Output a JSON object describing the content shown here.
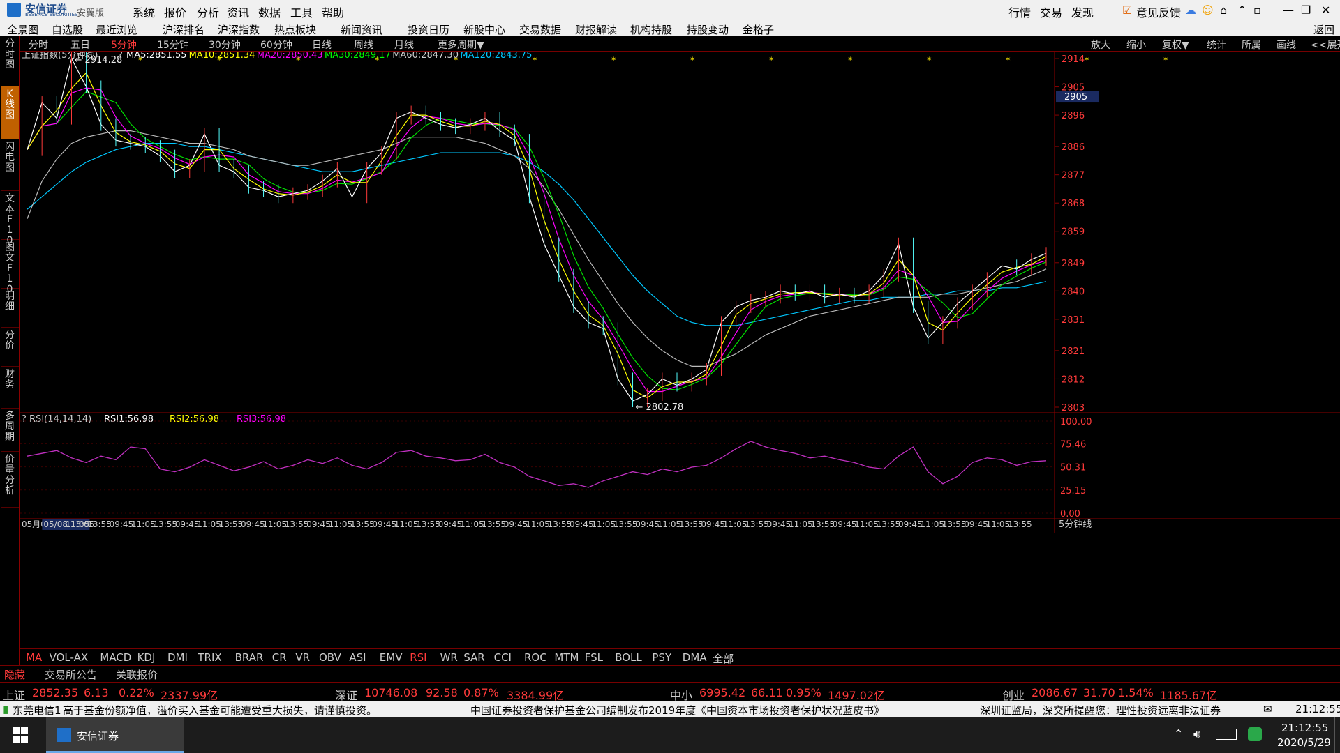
{
  "app": {
    "logo_text": "安信证券",
    "logo_sub": "ESSENCE SECURITIES",
    "version": "安翼版",
    "menu": [
      "系统",
      "报价",
      "分析",
      "资讯",
      "数据",
      "工具",
      "帮助"
    ],
    "right_menu": [
      "行情",
      "交易",
      "发现"
    ],
    "feedback": "意见反馈"
  },
  "toolbar2": {
    "items": [
      "全景图",
      "自选股",
      "最近浏览",
      "沪深排名",
      "沪深指数",
      "热点板块",
      "新闻资讯",
      "投资日历",
      "新股中心",
      "交易数据",
      "财报解读",
      "机构持股",
      "持股变动",
      "金格子"
    ],
    "back": "返回"
  },
  "sidebar": {
    "tabs": [
      "分时图",
      "K线图",
      "闪电图",
      "文本F10",
      "图文F10",
      "明细",
      "分价",
      "财务",
      "多周期",
      "价量分析"
    ]
  },
  "periods": {
    "items": [
      "分时",
      "五日",
      "5分钟",
      "15分钟",
      "30分钟",
      "60分钟",
      "日线",
      "周线",
      "月线",
      "更多周期▼"
    ],
    "active": "5分钟",
    "right_buttons": [
      "放大",
      "缩小",
      "复权▼",
      "统计",
      "所属",
      "画线",
      "<<展开"
    ]
  },
  "chart_data": {
    "type": "line",
    "title": "上证指数(5分钟线)",
    "ma_legend": [
      {
        "name": "MA5",
        "value": "2851.55",
        "color": "#ffffff"
      },
      {
        "name": "MA10",
        "value": "2851.34",
        "color": "#ffff00"
      },
      {
        "name": "MA20",
        "value": "2850.43",
        "color": "#ff00ff"
      },
      {
        "name": "MA30",
        "value": "2849.17",
        "color": "#00ff00"
      },
      {
        "name": "MA60",
        "value": "2847.30",
        "color": "#cccccc"
      },
      {
        "name": "MA120",
        "value": "2843.75",
        "color": "#00c8ff"
      }
    ],
    "y_ticks": [
      2914,
      2905,
      2896,
      2886,
      2877,
      2868,
      2859,
      2849,
      2840,
      2831,
      2821,
      2812,
      2803
    ],
    "ylim": [
      2803,
      2914
    ],
    "current_price_tag": "2905",
    "high_label": "2914.28",
    "low_label": "2802.78",
    "price_path": [
      2885,
      2900,
      2895,
      2914,
      2905,
      2893,
      2888,
      2887,
      2886,
      2883,
      2878,
      2880,
      2890,
      2880,
      2878,
      2873,
      2872,
      2870,
      2871,
      2872,
      2875,
      2879,
      2870,
      2879,
      2884,
      2895,
      2897,
      2895,
      2893,
      2892,
      2893,
      2895,
      2891,
      2888,
      2870,
      2855,
      2845,
      2835,
      2830,
      2828,
      2812,
      2805,
      2807,
      2812,
      2810,
      2812,
      2815,
      2830,
      2835,
      2837,
      2838,
      2840,
      2839,
      2840,
      2838,
      2839,
      2838,
      2840,
      2845,
      2855,
      2835,
      2825,
      2830,
      2836,
      2840,
      2844,
      2848,
      2847,
      2850,
      2852
    ],
    "ma60_path": [
      2863,
      2875,
      2882,
      2887,
      2889,
      2890,
      2891,
      2891,
      2890,
      2889,
      2888,
      2887,
      2887,
      2886,
      2885,
      2883,
      2882,
      2881,
      2880,
      2880,
      2881,
      2882,
      2883,
      2884,
      2885,
      2887,
      2889,
      2889,
      2889,
      2889,
      2888,
      2887,
      2885,
      2883,
      2879,
      2873,
      2866,
      2858,
      2850,
      2843,
      2836,
      2830,
      2825,
      2821,
      2818,
      2816,
      2816,
      2818,
      2820,
      2823,
      2826,
      2828,
      2830,
      2832,
      2833,
      2834,
      2835,
      2836,
      2837,
      2838,
      2838,
      2838,
      2839,
      2839,
      2840,
      2841,
      2842,
      2843,
      2845,
      2847
    ],
    "ma120_path": [
      2866,
      2870,
      2874,
      2878,
      2881,
      2883,
      2885,
      2886,
      2887,
      2887,
      2887,
      2886,
      2886,
      2885,
      2884,
      2883,
      2882,
      2881,
      2880,
      2879,
      2878,
      2878,
      2878,
      2879,
      2880,
      2881,
      2882,
      2883,
      2884,
      2884,
      2884,
      2884,
      2884,
      2883,
      2881,
      2878,
      2874,
      2869,
      2863,
      2857,
      2851,
      2845,
      2840,
      2836,
      2832,
      2830,
      2829,
      2829,
      2829,
      2830,
      2831,
      2832,
      2833,
      2834,
      2835,
      2836,
      2837,
      2837,
      2838,
      2838,
      2838,
      2839,
      2839,
      2840,
      2840,
      2840,
      2841,
      2841,
      2842,
      2843
    ],
    "rsi": {
      "title": "RSI(14,14,14)",
      "rsi1": "56.98",
      "rsi2": "56.98",
      "rsi3": "56.98",
      "y_ticks": [
        "100.00",
        "75.46",
        "50.31",
        "25.15",
        "0.00"
      ],
      "ylim": [
        0,
        100
      ],
      "values": [
        62,
        65,
        68,
        60,
        55,
        62,
        58,
        72,
        70,
        48,
        45,
        50,
        58,
        52,
        46,
        50,
        56,
        48,
        52,
        58,
        54,
        60,
        52,
        48,
        55,
        66,
        68,
        62,
        60,
        57,
        58,
        64,
        55,
        50,
        40,
        35,
        30,
        32,
        28,
        35,
        40,
        45,
        42,
        48,
        45,
        50,
        52,
        60,
        70,
        78,
        72,
        68,
        65,
        60,
        62,
        58,
        55,
        50,
        48,
        62,
        72,
        45,
        32,
        40,
        55,
        60,
        58,
        52,
        56,
        57
      ]
    },
    "x_ticks": [
      "05月06",
      "05/08 13:05",
      "11:05",
      "13:55",
      "09:45",
      "11:05",
      "13:55",
      "09:45",
      "11:05",
      "13:55",
      "09:45",
      "11:05",
      "13:55",
      "09:45",
      "11:05",
      "13:55",
      "09:45",
      "11:05",
      "13:55",
      "09:45",
      "11:05",
      "13:55",
      "09:45",
      "11:05",
      "13:55",
      "09:45",
      "11:05",
      "13:55",
      "09:45",
      "11:05",
      "13:55",
      "09:45",
      "11:05",
      "13:55",
      "09:45",
      "11:05",
      "13:55",
      "09:45",
      "11:05",
      "13:55",
      "09:45",
      "11:05",
      "13:55",
      "09:45",
      "11:05",
      "13:55"
    ],
    "x_tick_label_right": "5分钟线"
  },
  "indicators": {
    "items": [
      "MA",
      "VOL-AX",
      "MACD",
      "KDJ",
      "DMI",
      "TRIX",
      "BRAR",
      "CR",
      "VR",
      "OBV",
      "ASI",
      "EMV",
      "RSI",
      "WR",
      "SAR",
      "CCI",
      "ROC",
      "MTM",
      "FSL",
      "BOLL",
      "PSY",
      "DMA",
      "全部"
    ],
    "active": [
      "MA",
      "RSI"
    ]
  },
  "infobar": {
    "hide": "隐藏",
    "items": [
      "交易所公告",
      "关联报价"
    ]
  },
  "indices": [
    {
      "name": "上证",
      "price": "2852.35",
      "chg": "6.13",
      "pct": "0.22%",
      "amount": "2337.99亿"
    },
    {
      "name": "深证",
      "price": "10746.08",
      "chg": "92.58",
      "pct": "0.87%",
      "amount": "3384.99亿"
    },
    {
      "name": "中小",
      "price": "6995.42",
      "chg": "66.11",
      "pct": "0.95%",
      "amount": "1497.02亿"
    },
    {
      "name": "创业",
      "price": "2086.67",
      "chg": "31.70",
      "pct": "1.54%",
      "amount": "1185.67亿"
    }
  ],
  "ticker": {
    "server": "东莞电信1",
    "messages": [
      "高于基金份额净值，溢价买入基金可能遭受重大损失，请谨慎投资。",
      "中国证券投资者保护基金公司编制发布2019年度《中国资本市场投资者保护状况蓝皮书》",
      "深圳证监局，深交所提醒您：理性投资远离非法证券"
    ],
    "time": "21:12:55"
  },
  "taskbar": {
    "app_label": "安信证券",
    "clock_time": "21:12:55",
    "clock_date": "2020/5/29"
  },
  "colors": {
    "up": "#ff3a3a",
    "rsi": "#c030c0",
    "ma120": "#3ab0d0",
    "grid_red": "#700000"
  }
}
